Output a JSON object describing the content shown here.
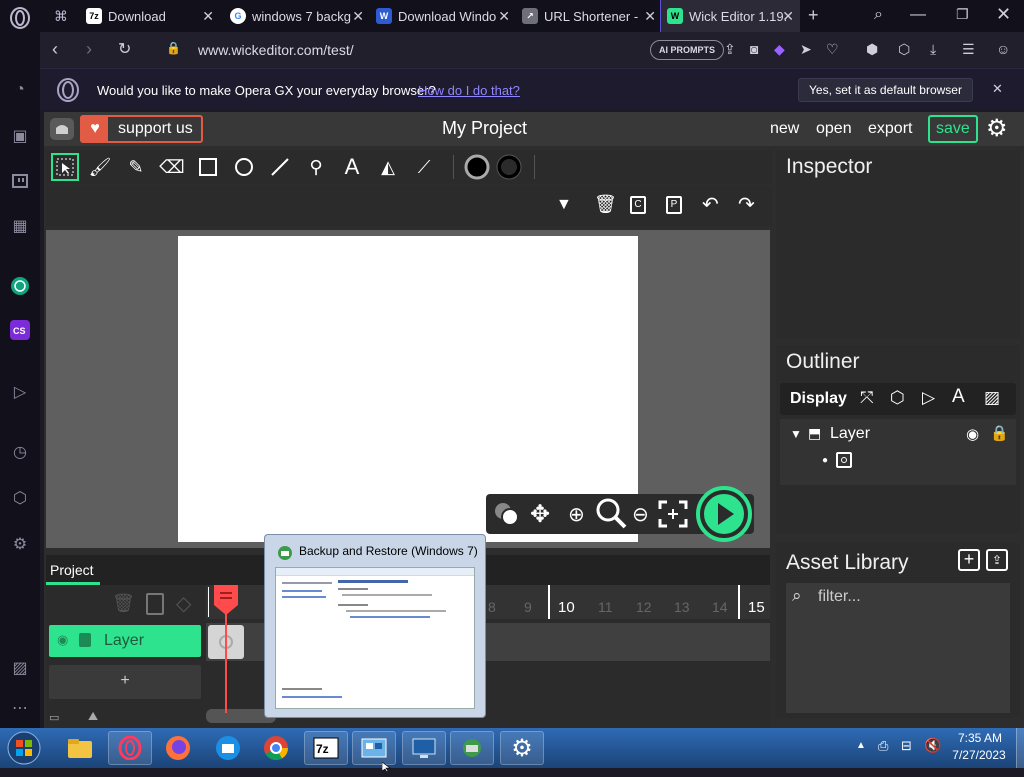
{
  "browser": {
    "tabs": [
      {
        "label": "Download",
        "favicon": "7z"
      },
      {
        "label": "windows 7 backg",
        "favicon": "G"
      },
      {
        "label": "Download Windo",
        "favicon": "W"
      },
      {
        "label": "URL Shortener - ",
        "favicon": "U"
      },
      {
        "label": "Wick Editor 1.19.",
        "favicon": "W",
        "active": true
      }
    ],
    "url": "www.wickeditor.com/test/",
    "ai_prompts_label": "AI PROMPTS",
    "notification": {
      "text": "Would you like to make Opera GX your everyday browser?",
      "link": "How do I do that?",
      "button": "Yes, set it as default browser"
    }
  },
  "wick": {
    "support_label": "support us",
    "project_title": "My Project",
    "menu": {
      "new": "new",
      "open": "open",
      "export": "export",
      "save": "save"
    },
    "inspector_title": "Inspector",
    "outliner": {
      "title": "Outliner",
      "display_label": "Display",
      "layer_name": "Layer"
    },
    "asset_library": {
      "title": "Asset Library",
      "filter_placeholder": "filter..."
    },
    "timeline": {
      "tab_label": "Project",
      "layer_label": "Layer",
      "add_label": "+",
      "frame_numbers": [
        "8",
        "9",
        "10",
        "11",
        "12",
        "13",
        "14",
        "15"
      ],
      "highlighted_frames": [
        "10",
        "15"
      ]
    }
  },
  "preview": {
    "title": "Backup and Restore (Windows 7)"
  },
  "taskbar": {
    "time": "7:35 AM",
    "date": "7/27/2023"
  }
}
